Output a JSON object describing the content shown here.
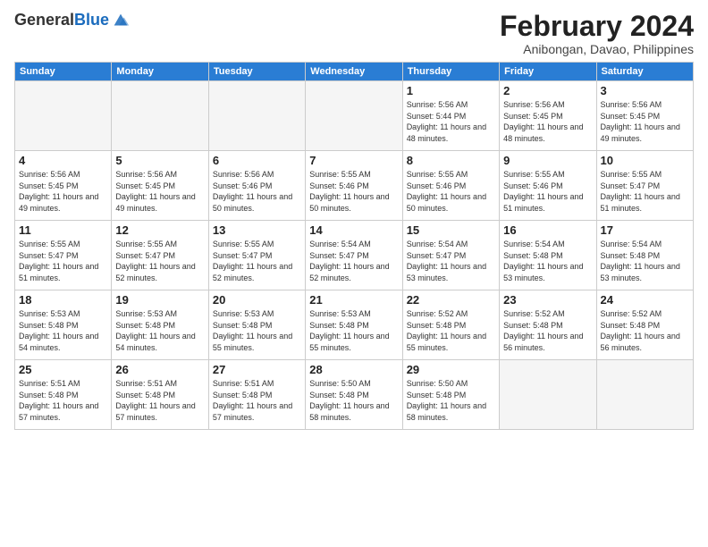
{
  "header": {
    "logo_general": "General",
    "logo_blue": "Blue",
    "title": "February 2024",
    "subtitle": "Anibongan, Davao, Philippines"
  },
  "days_of_week": [
    "Sunday",
    "Monday",
    "Tuesday",
    "Wednesday",
    "Thursday",
    "Friday",
    "Saturday"
  ],
  "weeks": [
    [
      {
        "num": "",
        "empty": true
      },
      {
        "num": "",
        "empty": true
      },
      {
        "num": "",
        "empty": true
      },
      {
        "num": "",
        "empty": true
      },
      {
        "num": "1",
        "sunrise": "5:56 AM",
        "sunset": "5:44 PM",
        "daylight": "11 hours and 48 minutes."
      },
      {
        "num": "2",
        "sunrise": "5:56 AM",
        "sunset": "5:45 PM",
        "daylight": "11 hours and 48 minutes."
      },
      {
        "num": "3",
        "sunrise": "5:56 AM",
        "sunset": "5:45 PM",
        "daylight": "11 hours and 49 minutes."
      }
    ],
    [
      {
        "num": "4",
        "sunrise": "5:56 AM",
        "sunset": "5:45 PM",
        "daylight": "11 hours and 49 minutes."
      },
      {
        "num": "5",
        "sunrise": "5:56 AM",
        "sunset": "5:45 PM",
        "daylight": "11 hours and 49 minutes."
      },
      {
        "num": "6",
        "sunrise": "5:56 AM",
        "sunset": "5:46 PM",
        "daylight": "11 hours and 50 minutes."
      },
      {
        "num": "7",
        "sunrise": "5:55 AM",
        "sunset": "5:46 PM",
        "daylight": "11 hours and 50 minutes."
      },
      {
        "num": "8",
        "sunrise": "5:55 AM",
        "sunset": "5:46 PM",
        "daylight": "11 hours and 50 minutes."
      },
      {
        "num": "9",
        "sunrise": "5:55 AM",
        "sunset": "5:46 PM",
        "daylight": "11 hours and 51 minutes."
      },
      {
        "num": "10",
        "sunrise": "5:55 AM",
        "sunset": "5:47 PM",
        "daylight": "11 hours and 51 minutes."
      }
    ],
    [
      {
        "num": "11",
        "sunrise": "5:55 AM",
        "sunset": "5:47 PM",
        "daylight": "11 hours and 51 minutes."
      },
      {
        "num": "12",
        "sunrise": "5:55 AM",
        "sunset": "5:47 PM",
        "daylight": "11 hours and 52 minutes."
      },
      {
        "num": "13",
        "sunrise": "5:55 AM",
        "sunset": "5:47 PM",
        "daylight": "11 hours and 52 minutes."
      },
      {
        "num": "14",
        "sunrise": "5:54 AM",
        "sunset": "5:47 PM",
        "daylight": "11 hours and 52 minutes."
      },
      {
        "num": "15",
        "sunrise": "5:54 AM",
        "sunset": "5:47 PM",
        "daylight": "11 hours and 53 minutes."
      },
      {
        "num": "16",
        "sunrise": "5:54 AM",
        "sunset": "5:48 PM",
        "daylight": "11 hours and 53 minutes."
      },
      {
        "num": "17",
        "sunrise": "5:54 AM",
        "sunset": "5:48 PM",
        "daylight": "11 hours and 53 minutes."
      }
    ],
    [
      {
        "num": "18",
        "sunrise": "5:53 AM",
        "sunset": "5:48 PM",
        "daylight": "11 hours and 54 minutes."
      },
      {
        "num": "19",
        "sunrise": "5:53 AM",
        "sunset": "5:48 PM",
        "daylight": "11 hours and 54 minutes."
      },
      {
        "num": "20",
        "sunrise": "5:53 AM",
        "sunset": "5:48 PM",
        "daylight": "11 hours and 55 minutes."
      },
      {
        "num": "21",
        "sunrise": "5:53 AM",
        "sunset": "5:48 PM",
        "daylight": "11 hours and 55 minutes."
      },
      {
        "num": "22",
        "sunrise": "5:52 AM",
        "sunset": "5:48 PM",
        "daylight": "11 hours and 55 minutes."
      },
      {
        "num": "23",
        "sunrise": "5:52 AM",
        "sunset": "5:48 PM",
        "daylight": "11 hours and 56 minutes."
      },
      {
        "num": "24",
        "sunrise": "5:52 AM",
        "sunset": "5:48 PM",
        "daylight": "11 hours and 56 minutes."
      }
    ],
    [
      {
        "num": "25",
        "sunrise": "5:51 AM",
        "sunset": "5:48 PM",
        "daylight": "11 hours and 57 minutes."
      },
      {
        "num": "26",
        "sunrise": "5:51 AM",
        "sunset": "5:48 PM",
        "daylight": "11 hours and 57 minutes."
      },
      {
        "num": "27",
        "sunrise": "5:51 AM",
        "sunset": "5:48 PM",
        "daylight": "11 hours and 57 minutes."
      },
      {
        "num": "28",
        "sunrise": "5:50 AM",
        "sunset": "5:48 PM",
        "daylight": "11 hours and 58 minutes."
      },
      {
        "num": "29",
        "sunrise": "5:50 AM",
        "sunset": "5:48 PM",
        "daylight": "11 hours and 58 minutes."
      },
      {
        "num": "",
        "empty": true
      },
      {
        "num": "",
        "empty": true
      }
    ]
  ]
}
